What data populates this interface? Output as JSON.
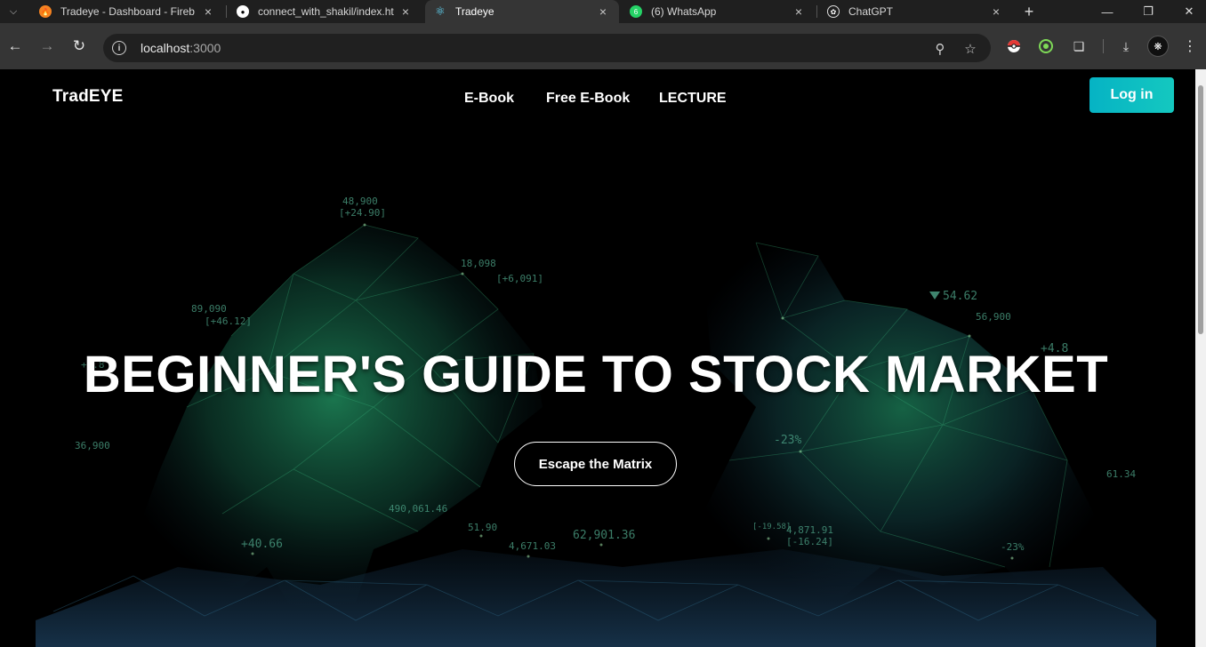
{
  "browser": {
    "tabs": [
      {
        "title": "Tradeye - Dashboard - Fireb",
        "icon": "firebase-icon",
        "active": false
      },
      {
        "title": "connect_with_shakil/index.ht",
        "icon": "github-icon",
        "active": false
      },
      {
        "title": "Tradeye",
        "icon": "react-icon",
        "active": true
      },
      {
        "title": "(6) WhatsApp",
        "icon": "whatsapp-icon",
        "active": false
      },
      {
        "title": "ChatGPT",
        "icon": "chatgpt-icon",
        "active": false
      }
    ],
    "address": {
      "host": "localhost",
      "port": ":3000"
    }
  },
  "site": {
    "logo": "TradEYE",
    "nav": [
      "E-Book",
      "Free E-Book",
      "LECTURE"
    ],
    "login_label": "Log in",
    "hero_title": "BEGINNER'S GUIDE TO STOCK MARKET",
    "cta_label": "Escape the Matrix",
    "accent": "#0fbec4",
    "bg_tickers": [
      "48,900",
      "[+24.90]",
      "18,098",
      "[+6,091]",
      "89,090",
      "[+46.12]",
      "+0.8",
      "36,900",
      "490,061.46",
      "+40.66",
      "51.90",
      "4,671.03",
      "62,901.36",
      "54.62",
      "56,900",
      "+4.8",
      "-23%",
      "4,871.91",
      "[-16.24]",
      "-23%",
      "61.34",
      "[-19.58]"
    ]
  }
}
